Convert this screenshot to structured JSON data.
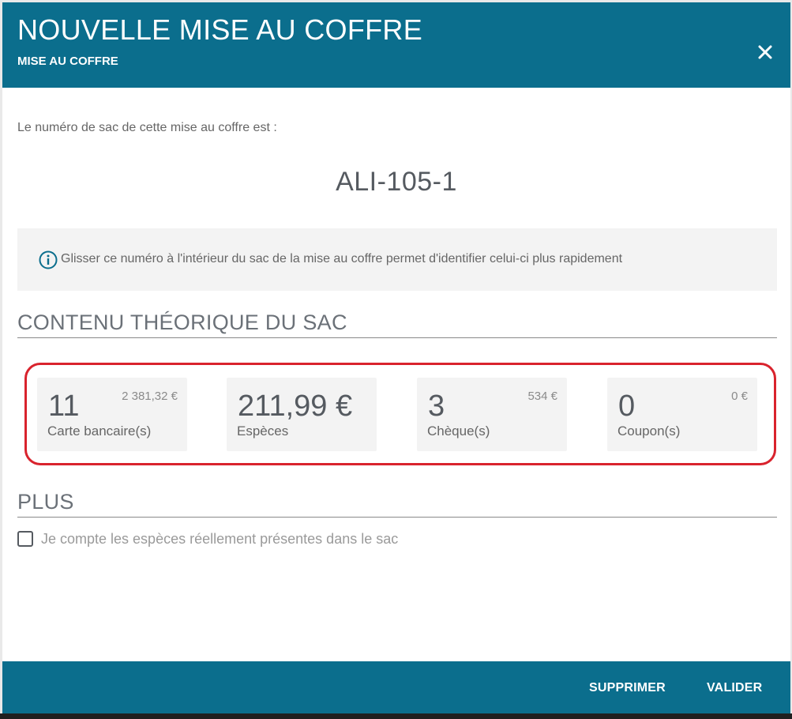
{
  "header": {
    "title": "NOUVELLE MISE AU COFFRE",
    "subtitle": "MISE AU COFFRE",
    "close_icon": "close-icon"
  },
  "intro": {
    "text": "Le numéro de sac de cette mise au coffre est :",
    "bag_number": "ALI-105-1"
  },
  "info": {
    "icon": "info-icon",
    "text": "Glisser ce numéro à l'intérieur du sac de la mise au coffre permet d'identifier celui-ci plus rapidement"
  },
  "contents": {
    "title": "CONTENU THÉORIQUE DU SAC",
    "cards": [
      {
        "count": "11",
        "label": "Carte bancaire(s)",
        "amount": "2 381,32 €"
      },
      {
        "count": "211,99 €",
        "label": "Espèces",
        "amount": ""
      },
      {
        "count": "3",
        "label": "Chèque(s)",
        "amount": "534 €"
      },
      {
        "count": "0",
        "label": "Coupon(s)",
        "amount": "0 €"
      }
    ]
  },
  "more": {
    "title": "PLUS",
    "checkbox_label": "Je compte les espèces réellement présentes dans le sac",
    "checked": false
  },
  "footer": {
    "delete_label": "SUPPRIMER",
    "validate_label": "VALIDER"
  },
  "colors": {
    "brand": "#0b6e8d",
    "highlight": "#d9232d"
  }
}
